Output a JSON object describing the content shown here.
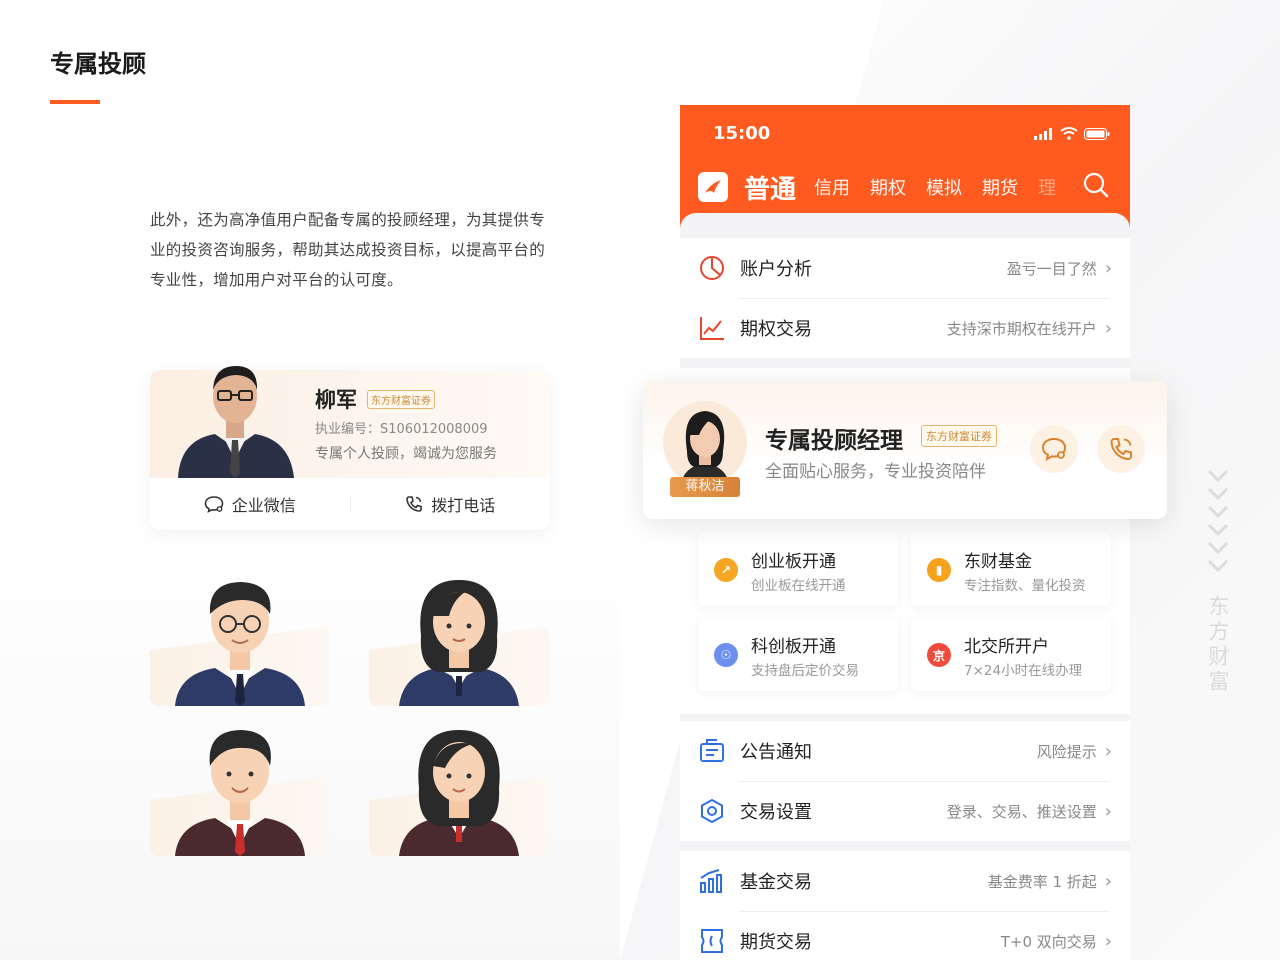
{
  "left": {
    "title": "专属投顾",
    "description": "此外，还为高净值用户配备专属的投顾经理，为其提供专业的投资咨询服务，帮助其达成投资目标，以提高平台的专业性，增加用户对平台的认可度。",
    "adviser": {
      "name": "柳军",
      "company_tag": "东方财富证券",
      "license": "执业编号：S106012008009",
      "slogan": "专属个人投顾，竭诚为您服务",
      "wechat_label": "企业微信",
      "call_label": "拨打电话"
    }
  },
  "phone": {
    "time": "15:00",
    "nav": {
      "main": "普通",
      "items": [
        "信用",
        "期权",
        "模拟",
        "期货"
      ],
      "fade": "理"
    },
    "rows_top": [
      {
        "title": "账户分析",
        "sub": "盈亏一目了然",
        "icon": "pie-chart-icon"
      },
      {
        "title": "期权交易",
        "sub": "支持深市期权在线开户",
        "icon": "line-chart-icon"
      }
    ],
    "adviser_card": {
      "name": "蒋秋洁",
      "title": "专属投顾经理",
      "company_tag": "东方财富证券",
      "sub": "全面贴心服务，专业投资陪伴"
    },
    "grid": [
      {
        "title": "创业板开通",
        "sub": "创业板在线开通",
        "color": "#f5a623",
        "glyph": "↗"
      },
      {
        "title": "东财基金",
        "sub": "专注指数、量化投资",
        "color": "#f6a21d",
        "glyph": "▮"
      },
      {
        "title": "科创板开通",
        "sub": "支持盘后定价交易",
        "color": "#6c8ff0",
        "glyph": "☉"
      },
      {
        "title": "北交所开户",
        "sub": "7×24小时在线办理",
        "color": "#ef4b3c",
        "glyph": "京"
      }
    ],
    "rows_mid": [
      {
        "title": "公告通知",
        "sub": "风险提示",
        "icon": "notice-icon"
      },
      {
        "title": "交易设置",
        "sub": "登录、交易、推送设置",
        "icon": "hexagon-settings-icon"
      }
    ],
    "rows_bottom": [
      {
        "title": "基金交易",
        "sub": "基金费率 1 折起",
        "icon": "bar-chart-icon"
      },
      {
        "title": "期货交易",
        "sub": "T+0 双向交易",
        "icon": "ticket-icon"
      }
    ]
  },
  "brand_vertical": "东方财富",
  "colors": {
    "accent": "#ff5a1f",
    "tag": "#c9893a"
  }
}
